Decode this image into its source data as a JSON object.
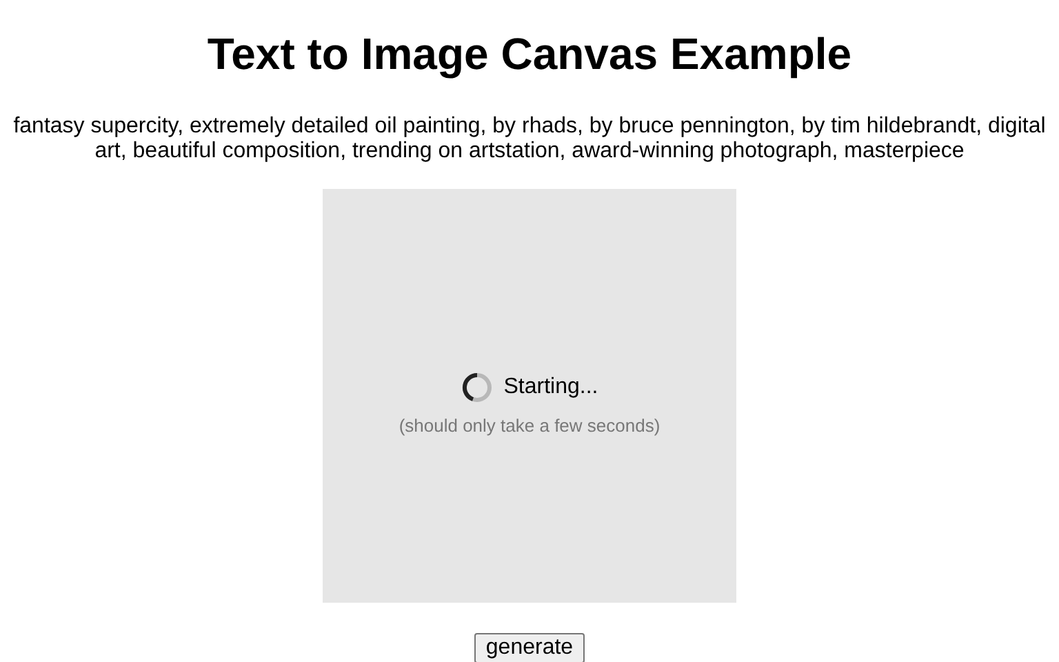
{
  "title": "Text to Image Canvas Example",
  "prompt": "fantasy supercity, extremely detailed oil painting, by rhads, by bruce pennington, by tim hildebrandt, digital art, beautiful composition, trending on artstation, award-winning photograph, masterpiece",
  "canvas": {
    "status": "Starting...",
    "hint": "(should only take a few seconds)"
  },
  "button": "generate"
}
